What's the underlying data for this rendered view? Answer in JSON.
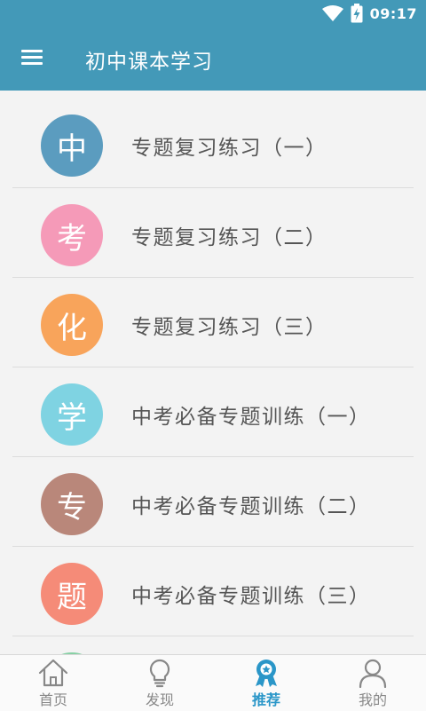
{
  "status": {
    "time": "09:17"
  },
  "header": {
    "title": "初中课本学习"
  },
  "items": [
    {
      "badge": "中",
      "label": "专题复习练习（一）",
      "color": "#5b9cbf"
    },
    {
      "badge": "考",
      "label": "专题复习练习（二）",
      "color": "#f59ab8"
    },
    {
      "badge": "化",
      "label": "专题复习练习（三）",
      "color": "#f8a45b"
    },
    {
      "badge": "学",
      "label": "中考必备专题训练（一）",
      "color": "#7fd3e2"
    },
    {
      "badge": "专",
      "label": "中考必备专题训练（二）",
      "color": "#b9877a"
    },
    {
      "badge": "题",
      "label": "中考必备专题训练（三）",
      "color": "#f58b78"
    },
    {
      "badge": "",
      "label": "",
      "color": "#86d0a4"
    }
  ],
  "tabs": [
    {
      "label": "首页",
      "icon": "home-icon",
      "active": false
    },
    {
      "label": "发现",
      "icon": "lightbulb-icon",
      "active": false
    },
    {
      "label": "推荐",
      "icon": "award-icon",
      "active": true
    },
    {
      "label": "我的",
      "icon": "user-icon",
      "active": false
    }
  ],
  "colors": {
    "primary": "#4399b8",
    "tab_active": "#2a96c8",
    "tab_inactive": "#888888"
  }
}
